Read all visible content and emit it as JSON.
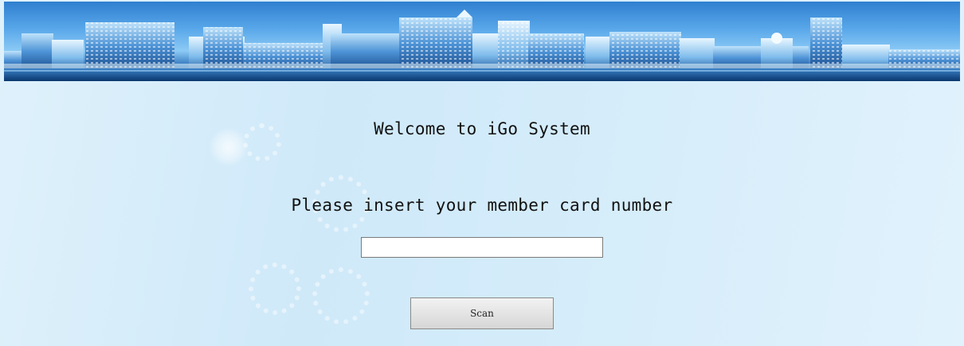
{
  "banner": {
    "description_icon": "city-skyline-image"
  },
  "welcome_text": "Welcome to iGo System",
  "prompt_text": "Please insert your member card number",
  "member_card_input": {
    "value": "",
    "placeholder": ""
  },
  "scan_button": {
    "label": "Scan"
  },
  "colors": {
    "background": "#d6edfa",
    "banner_sky": "#5aa8ea",
    "banner_water": "#0c3f7c",
    "button_face": "#e4e4e4"
  }
}
